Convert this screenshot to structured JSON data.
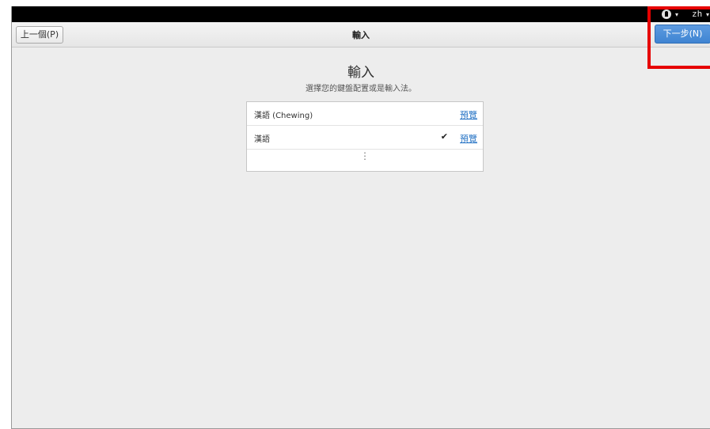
{
  "topbar": {
    "accessibility_icon": "accessibility-icon",
    "caret": "▾",
    "language": "zh"
  },
  "header": {
    "prev_button": "上一個(P)",
    "title": "輸入",
    "next_button": "下一步(N)"
  },
  "main": {
    "heading": "輸入",
    "subtitle": "選擇您的鍵盤配置或是輸入法。"
  },
  "input_list": {
    "items": [
      {
        "label": "漢語 (Chewing)",
        "preview": "預覽",
        "selected": false
      },
      {
        "label": "漢語",
        "preview": "預覽",
        "selected": true,
        "check": "✔"
      }
    ],
    "more": "⋮"
  },
  "colors": {
    "highlight": "#e60000",
    "next_button": "#4a8fd8",
    "link": "#2a76c6"
  }
}
